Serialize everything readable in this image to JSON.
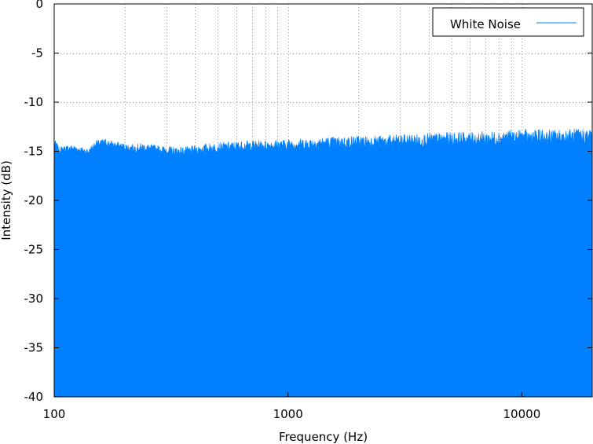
{
  "chart_data": {
    "type": "area",
    "title": "",
    "xlabel": "Frequency (Hz)",
    "ylabel": "Intensity (dB)",
    "x_scale": "log",
    "xlim": [
      100,
      20000
    ],
    "ylim": [
      -40,
      0
    ],
    "grid": true,
    "legend_position": "top-right",
    "x_ticks": [
      {
        "value": 100,
        "label": "100"
      },
      {
        "value": 1000,
        "label": "1000"
      },
      {
        "value": 10000,
        "label": "10000"
      }
    ],
    "y_ticks": [
      {
        "value": 0,
        "label": "0"
      },
      {
        "value": -5,
        "label": "-5"
      },
      {
        "value": -10,
        "label": "-10"
      },
      {
        "value": -15,
        "label": "-15"
      },
      {
        "value": -20,
        "label": "-20"
      },
      {
        "value": -25,
        "label": "-25"
      },
      {
        "value": -30,
        "label": "-30"
      },
      {
        "value": -35,
        "label": "-35"
      },
      {
        "value": -40,
        "label": "-40"
      }
    ],
    "series": [
      {
        "name": "White Noise",
        "color": "#0080ff",
        "x": [
          100,
          105,
          110,
          120,
          130,
          140,
          150,
          165,
          180,
          200,
          220,
          240,
          270,
          300,
          330,
          360,
          400,
          450,
          500,
          600,
          700,
          800,
          1000,
          1200,
          1500,
          2000,
          2500,
          3000,
          4000,
          5000,
          6000,
          8000,
          10000,
          12000,
          15000,
          18000,
          20000
        ],
        "y": [
          -14.0,
          -14.8,
          -14.7,
          -14.6,
          -14.8,
          -15.0,
          -14.2,
          -14.0,
          -14.3,
          -14.5,
          -14.6,
          -14.5,
          -14.7,
          -14.8,
          -14.9,
          -14.9,
          -14.8,
          -14.6,
          -14.5,
          -14.4,
          -14.3,
          -14.3,
          -14.2,
          -14.1,
          -14.0,
          -13.9,
          -13.9,
          -13.8,
          -13.7,
          -13.6,
          -13.6,
          -13.5,
          -13.4,
          -13.4,
          -13.4,
          -13.3,
          -13.3
        ]
      }
    ]
  }
}
